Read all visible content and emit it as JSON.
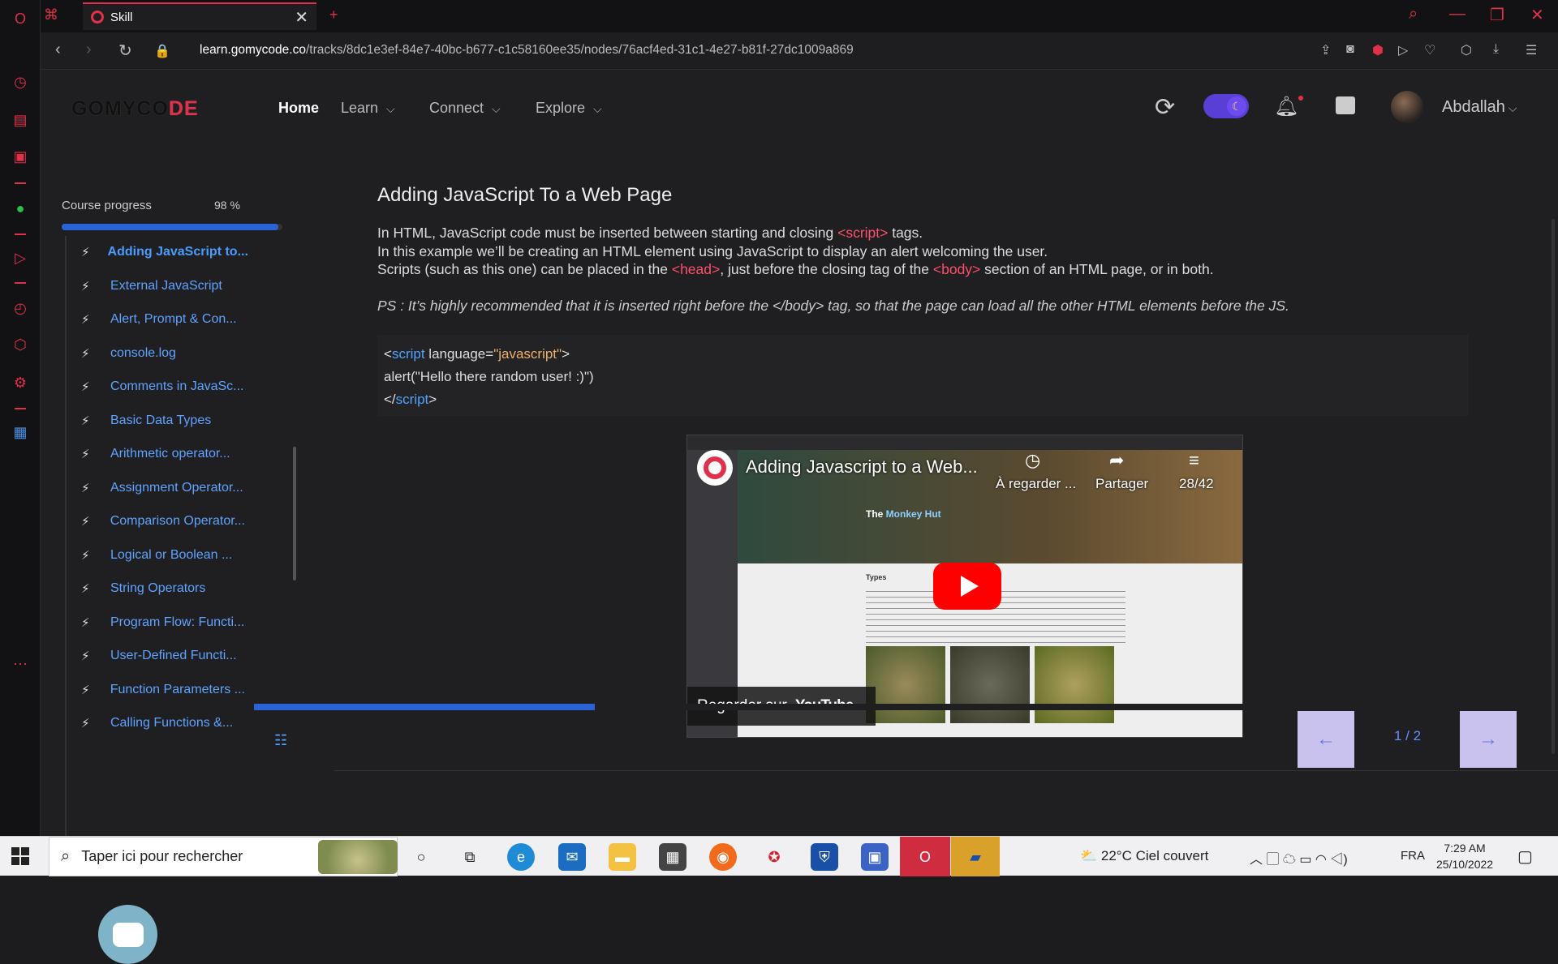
{
  "browser": {
    "tab_title": "Skill",
    "url_domain": "learn.gomycode.co",
    "url_path": "/tracks/8dc1e3ef-84e7-40bc-b677-c1c58160ee35/nodes/76acf4ed-31c1-4e27-b81f-27dc1009a869"
  },
  "header": {
    "logo": "GOMYCODE",
    "nav": [
      {
        "label": "Home"
      },
      {
        "label": "Learn"
      },
      {
        "label": "Connect"
      },
      {
        "label": "Explore"
      }
    ],
    "username": "Abdallah"
  },
  "sidebar": {
    "progress_label": "Course progress",
    "progress_value": "98 %",
    "progress_fraction": 0.98,
    "lessons": [
      {
        "label": "Adding JavaScript to..."
      },
      {
        "label": "External JavaScript"
      },
      {
        "label": "Alert, Prompt & Con..."
      },
      {
        "label": "console.log"
      },
      {
        "label": "Comments in JavaSc..."
      },
      {
        "label": "Basic Data Types"
      },
      {
        "label": "Arithmetic operator..."
      },
      {
        "label": "Assignment Operator..."
      },
      {
        "label": "Comparison Operator..."
      },
      {
        "label": "Logical or Boolean ..."
      },
      {
        "label": "String Operators"
      },
      {
        "label": "Program Flow: Functi..."
      },
      {
        "label": "User-Defined Functi..."
      },
      {
        "label": "Function Parameters ..."
      },
      {
        "label": "Calling Functions &..."
      }
    ]
  },
  "lesson": {
    "title": "Adding JavaScript To a Web Page",
    "p1_a": "In HTML, JavaScript code must be inserted between starting and closing ",
    "p1_tag": "<script>",
    "p1_b": " tags.",
    "p2": "In this example we’ll be creating an HTML element using JavaScript to display an alert welcoming the user.",
    "p3_a": "Scripts (such as this one) can be placed in the ",
    "p3_tag1": "<head>",
    "p3_b": ", just before the closing tag of the ",
    "p3_tag2": "<body>",
    "p3_c": " section of an HTML page, or in both.",
    "ps": "PS : It’s highly recommended that it is inserted right before the </body> tag, so that the page can load all the other HTML elements before the JS.",
    "code": {
      "l1_open": "<",
      "l1_kw": "script",
      "l1_attr": " language",
      "l1_eq": "=",
      "l1_str": "\"javascript\"",
      "l1_close": ">",
      "l2": "alert(\"Hello there random user! :)\")",
      "l3_open": "</",
      "l3_kw": "script",
      "l3_close": ">"
    }
  },
  "video": {
    "title": "Adding Javascript to a Web...",
    "watch_later": "À regarder ...",
    "share": "Partager",
    "playlist_count": "28/42",
    "embedded_brand_a": "The ",
    "embedded_brand_b": "Monkey Hut",
    "embedded_heading": "Types",
    "watch_on": "Regarder sur",
    "youtube": "YouTube"
  },
  "pager": {
    "indicator": "1 / 2",
    "video_progress_fraction": 0.27
  },
  "taskbar": {
    "search_placeholder": "Taper ici pour rechercher",
    "weather": "22°C  Ciel couvert",
    "language": "FRA",
    "time": "7:29 AM",
    "date": "25/10/2022"
  },
  "colors": {
    "accent_red": "#e0304a",
    "link_blue": "#4a9dff",
    "progress_blue": "#2a63d6",
    "tag_pink": "#ff4f6b"
  }
}
